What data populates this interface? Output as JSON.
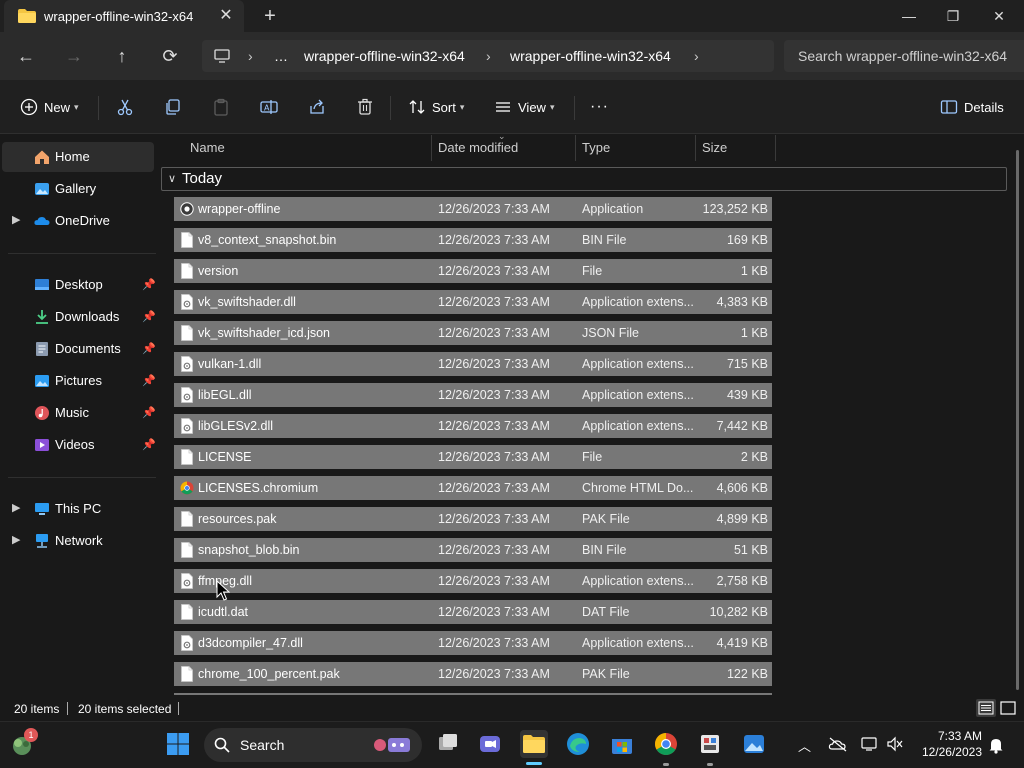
{
  "window": {
    "tab_title": "wrapper-offline-win32-x64",
    "new_tab": "+",
    "close_tab": "✕",
    "minimize": "—",
    "maximize": "❐",
    "close": "✕"
  },
  "nav": {
    "back": "←",
    "forward": "→",
    "up": "↑",
    "refresh": "⟳",
    "breadcrumb": [
      "…",
      "wrapper-offline-win32-x64",
      "wrapper-offline-win32-x64"
    ],
    "sep": "›",
    "search_placeholder": "Search wrapper-offline-win32-x64"
  },
  "toolbar": {
    "new": "New",
    "sort": "Sort",
    "view": "View",
    "more": "···",
    "details": "Details"
  },
  "sidebar": {
    "top": [
      {
        "label": "Home",
        "icon": "home-icon"
      },
      {
        "label": "Gallery",
        "icon": "gallery-icon"
      },
      {
        "label": "OneDrive",
        "icon": "onedrive-icon"
      }
    ],
    "quick": [
      {
        "label": "Desktop",
        "icon": "desktop-icon"
      },
      {
        "label": "Downloads",
        "icon": "downloads-icon"
      },
      {
        "label": "Documents",
        "icon": "documents-icon"
      },
      {
        "label": "Pictures",
        "icon": "pictures-icon"
      },
      {
        "label": "Music",
        "icon": "music-icon"
      },
      {
        "label": "Videos",
        "icon": "videos-icon"
      }
    ],
    "bottom": [
      {
        "label": "This PC",
        "icon": "pc-icon"
      },
      {
        "label": "Network",
        "icon": "network-icon"
      }
    ]
  },
  "columns": {
    "name": "Name",
    "date": "Date modified",
    "type": "Type",
    "size": "Size"
  },
  "group": "Today",
  "files": [
    {
      "name": "wrapper-offline",
      "date": "12/26/2023 7:33 AM",
      "type": "Application",
      "size": "123,252 KB",
      "icon": "app"
    },
    {
      "name": "v8_context_snapshot.bin",
      "date": "12/26/2023 7:33 AM",
      "type": "BIN File",
      "size": "169 KB",
      "icon": "file"
    },
    {
      "name": "version",
      "date": "12/26/2023 7:33 AM",
      "type": "File",
      "size": "1 KB",
      "icon": "file"
    },
    {
      "name": "vk_swiftshader.dll",
      "date": "12/26/2023 7:33 AM",
      "type": "Application extens...",
      "size": "4,383 KB",
      "icon": "dll"
    },
    {
      "name": "vk_swiftshader_icd.json",
      "date": "12/26/2023 7:33 AM",
      "type": "JSON File",
      "size": "1 KB",
      "icon": "file"
    },
    {
      "name": "vulkan-1.dll",
      "date": "12/26/2023 7:33 AM",
      "type": "Application extens...",
      "size": "715 KB",
      "icon": "dll"
    },
    {
      "name": "libEGL.dll",
      "date": "12/26/2023 7:33 AM",
      "type": "Application extens...",
      "size": "439 KB",
      "icon": "dll"
    },
    {
      "name": "libGLESv2.dll",
      "date": "12/26/2023 7:33 AM",
      "type": "Application extens...",
      "size": "7,442 KB",
      "icon": "dll"
    },
    {
      "name": "LICENSE",
      "date": "12/26/2023 7:33 AM",
      "type": "File",
      "size": "2 KB",
      "icon": "file"
    },
    {
      "name": "LICENSES.chromium",
      "date": "12/26/2023 7:33 AM",
      "type": "Chrome HTML Do...",
      "size": "4,606 KB",
      "icon": "chrome"
    },
    {
      "name": "resources.pak",
      "date": "12/26/2023 7:33 AM",
      "type": "PAK File",
      "size": "4,899 KB",
      "icon": "file"
    },
    {
      "name": "snapshot_blob.bin",
      "date": "12/26/2023 7:33 AM",
      "type": "BIN File",
      "size": "51 KB",
      "icon": "file"
    },
    {
      "name": "ffmpeg.dll",
      "date": "12/26/2023 7:33 AM",
      "type": "Application extens...",
      "size": "2,758 KB",
      "icon": "dll"
    },
    {
      "name": "icudtl.dat",
      "date": "12/26/2023 7:33 AM",
      "type": "DAT File",
      "size": "10,282 KB",
      "icon": "file"
    },
    {
      "name": "d3dcompiler_47.dll",
      "date": "12/26/2023 7:33 AM",
      "type": "Application extens...",
      "size": "4,419 KB",
      "icon": "dll"
    },
    {
      "name": "chrome_100_percent.pak",
      "date": "12/26/2023 7:33 AM",
      "type": "PAK File",
      "size": "122 KB",
      "icon": "file"
    }
  ],
  "status": {
    "count": "20 items",
    "selected": "20 items selected"
  },
  "taskbar": {
    "search": "Search",
    "time": "7:33 AM",
    "date": "12/26/2023",
    "badge": "1"
  }
}
